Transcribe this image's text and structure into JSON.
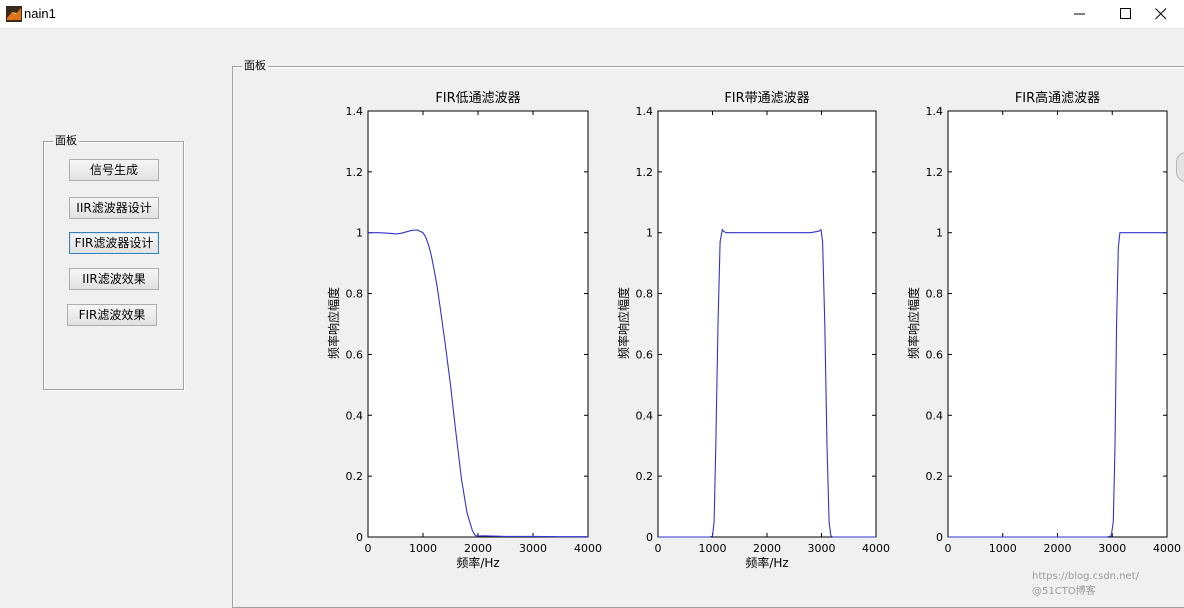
{
  "window": {
    "title": "nain1"
  },
  "left_panel": {
    "title": "面板",
    "buttons": [
      {
        "label": "信号生成"
      },
      {
        "label": "IIR滤波器设计"
      },
      {
        "label": "FIR滤波器设计",
        "focused": true
      },
      {
        "label": "IIR滤波效果"
      },
      {
        "label": "FIR滤波效果"
      }
    ]
  },
  "main_panel": {
    "title": "面板"
  },
  "colors": {
    "line": "#3333cc",
    "window_bg": "#f0f0f0"
  },
  "chart_data": [
    {
      "type": "line",
      "title": "FIR低通滤波器",
      "xlabel": "频率/Hz",
      "ylabel": "频率响应幅度",
      "xlim": [
        0,
        4000
      ],
      "ylim": [
        0,
        1.4
      ],
      "xticks": [
        "0",
        "1000",
        "2000",
        "3000",
        "4000"
      ],
      "yticks": [
        "0",
        "0.2",
        "0.4",
        "0.6",
        "0.8",
        "1",
        "1.2",
        "1.4"
      ],
      "series": [
        {
          "x": [
            0,
            200,
            400,
            500,
            600,
            700,
            800,
            900,
            1000,
            1050,
            1100,
            1150,
            1200,
            1250,
            1300,
            1400,
            1500,
            1600,
            1700,
            1800,
            1900,
            1950,
            2000,
            2100,
            2500,
            3000,
            3500,
            4000
          ],
          "y": [
            1.0,
            1.0,
            0.998,
            0.996,
            0.998,
            1.003,
            1.008,
            1.009,
            1.0,
            0.985,
            0.96,
            0.925,
            0.88,
            0.83,
            0.77,
            0.64,
            0.5,
            0.34,
            0.19,
            0.08,
            0.02,
            0.005,
            0.003,
            0.004,
            0.002,
            0.002,
            0.001,
            0.001
          ]
        }
      ]
    },
    {
      "type": "line",
      "title": "FIR带通滤波器",
      "xlabel": "频率/Hz",
      "ylabel": "频率响应幅度",
      "xlim": [
        0,
        4000
      ],
      "ylim": [
        0,
        1.4
      ],
      "xticks": [
        "0",
        "1000",
        "2000",
        "3000",
        "4000"
      ],
      "yticks": [
        "0",
        "0.2",
        "0.4",
        "0.6",
        "0.8",
        "1",
        "1.2",
        "1.4"
      ],
      "series": [
        {
          "x": [
            0,
            500,
            950,
            1000,
            1030,
            1060,
            1100,
            1140,
            1180,
            1200,
            1250,
            1500,
            2000,
            2500,
            2800,
            2950,
            2990,
            3020,
            3060,
            3100,
            3140,
            3170,
            3200,
            3500,
            4000
          ],
          "y": [
            0,
            0,
            0.0,
            0.003,
            0.05,
            0.3,
            0.7,
            0.97,
            1.01,
            1.005,
            1.0,
            1.0,
            1.0,
            1.0,
            1.0,
            1.005,
            1.01,
            0.97,
            0.7,
            0.3,
            0.05,
            0.005,
            0.0,
            0.0,
            0.0
          ]
        }
      ]
    },
    {
      "type": "line",
      "title": "FIR高通滤波器",
      "xlabel": "",
      "ylabel": "频率响应幅度",
      "xlim": [
        0,
        4000
      ],
      "ylim": [
        0,
        1.4
      ],
      "xticks": [
        "0",
        "1000",
        "2000",
        "3000",
        "4000"
      ],
      "yticks": [
        "0",
        "0.2",
        "0.4",
        "0.6",
        "0.8",
        "1",
        "1.2",
        "1.4"
      ],
      "series": [
        {
          "x": [
            0,
            1000,
            2000,
            2900,
            2980,
            3020,
            3050,
            3080,
            3110,
            3140,
            3170,
            3200,
            3500,
            4000
          ],
          "y": [
            0,
            0,
            0,
            0.0,
            0.003,
            0.05,
            0.3,
            0.7,
            0.95,
            1.0,
            1.0,
            1.0,
            1.0,
            1.0
          ]
        }
      ]
    }
  ],
  "watermark": "https://blog.csdn.net/ @51CTO博客"
}
